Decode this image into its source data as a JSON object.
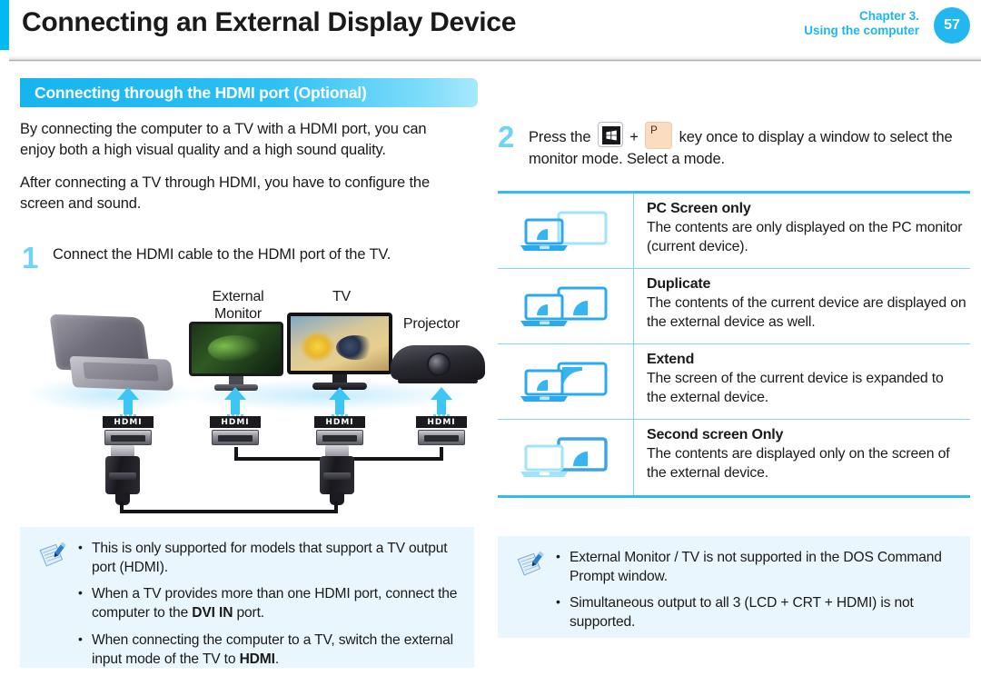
{
  "header": {
    "title": "Connecting an External Display Device",
    "chapter_line1": "Chapter 3.",
    "chapter_line2": "Using the computer",
    "page_number": "57",
    "accent_color": "#00baf2"
  },
  "section": {
    "bar_title": "Connecting through the HDMI port (Optional)",
    "intro_paragraph_1": "By connecting the computer to a TV with a HDMI port, you can enjoy both a high visual quality and a high sound quality.",
    "intro_paragraph_2": "After connecting a TV through HDMI, you have to configure the screen and sound."
  },
  "steps": [
    {
      "number": "1",
      "text": "Connect the HDMI cable to the HDMI port of the TV."
    },
    {
      "number": "2",
      "text_before_keys": "Press the",
      "key1": "windows-key",
      "plus": "+",
      "key2": "P",
      "text_after_keys": "key once to display a window to select the monitor mode. Select a mode."
    }
  ],
  "diagram": {
    "labels": {
      "monitor_line1": "External",
      "monitor_line2": "Monitor",
      "tv": "TV",
      "projector": "Projector"
    },
    "port_label": "HDMI",
    "devices": [
      "laptop",
      "external-monitor",
      "tv",
      "projector"
    ]
  },
  "mode_table": {
    "rows": [
      {
        "icon": "pc-screen-only-icon",
        "title": "PC Screen only",
        "desc": "The contents are only displayed on the PC monitor (current device)."
      },
      {
        "icon": "duplicate-icon",
        "title": "Duplicate",
        "desc": "The contents of the current device are displayed on the external device as well."
      },
      {
        "icon": "extend-icon",
        "title": "Extend",
        "desc": "The screen of the current device is expanded to the external device."
      },
      {
        "icon": "second-screen-only-icon",
        "title": "Second screen Only",
        "desc": "The contents are displayed only on the screen of the external device."
      }
    ],
    "border_color": "#2fbcf2"
  },
  "note_left": {
    "icon": "note-pencil-icon",
    "items": [
      {
        "pre": "This is only supported for models that support a TV output port (HDMI).",
        "bold": "",
        "post": ""
      },
      {
        "pre": "When a TV provides more than one HDMI port, connect the computer to the ",
        "bold": "DVI IN",
        "post": " port."
      },
      {
        "pre": "When connecting the computer to a TV, switch the external input mode of the TV to ",
        "bold": "HDMI",
        "post": "."
      }
    ]
  },
  "note_right": {
    "icon": "note-pencil-icon",
    "items": [
      {
        "pre": "External Monitor / TV is not supported in the DOS Command Prompt window.",
        "bold": "",
        "post": ""
      },
      {
        "pre": "Simultaneous output to all 3 (LCD + CRT + HDMI) is not supported.",
        "bold": "",
        "post": ""
      }
    ]
  }
}
